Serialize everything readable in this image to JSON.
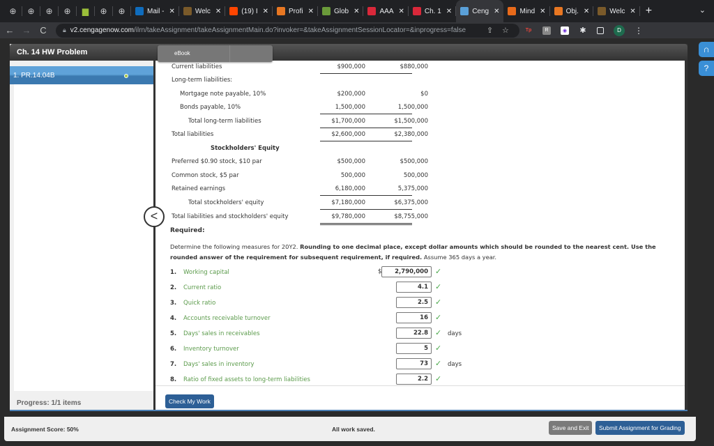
{
  "browser": {
    "tabs": [
      {
        "label": "Mail -",
        "icon": "outlook-icon",
        "color": "#0f6cbd"
      },
      {
        "label": "Welc",
        "icon": "welcome-icon",
        "color": "#7a5a2a"
      },
      {
        "label": "(19) I",
        "icon": "reddit-icon",
        "color": "#ff4500"
      },
      {
        "label": "Profi",
        "icon": "chegg-icon",
        "color": "#e87722"
      },
      {
        "label": "Glob",
        "icon": "bnc-icon",
        "color": "#6a9a3a"
      },
      {
        "label": "AAA",
        "icon": "aaa-icon",
        "color": "#d9283a"
      },
      {
        "label": "Ch. 1",
        "icon": "cengage-icon",
        "color": "#d9283a"
      },
      {
        "label": "Ceng",
        "icon": "cengage-icon",
        "color": "#5aa0d8",
        "active": true
      },
      {
        "label": "Mind",
        "icon": "mindtap-icon",
        "color": "#e86a1a"
      },
      {
        "label": "Obj.",
        "icon": "chegg-icon",
        "color": "#e87722"
      },
      {
        "label": "Welc",
        "icon": "welcome-icon",
        "color": "#7a5a2a"
      }
    ],
    "new_tab": "+",
    "tab_menu": "⌄",
    "url_host": "v2.cengagenow.com",
    "url_path": "/ilrn/takeAssignment/takeAssignmentMain.do?invoker=&takeAssignmentSessionLocator=&inprogress=false",
    "profile_initial": "D"
  },
  "sidebar": {
    "title": "Ch. 14 HW Problem",
    "items": [
      {
        "label": "1. PR.14.04B",
        "status": "complete"
      }
    ],
    "progress": "Progress:  1/1 items"
  },
  "main": {
    "tabs": [
      {
        "label": "eBook"
      }
    ],
    "balance_sheet": [
      {
        "label": "Current liabilities",
        "v1": "$900,000",
        "v2": "$880,000",
        "indent": 0,
        "rule": "single"
      },
      {
        "label": "Long-term liabilities:",
        "v1": "",
        "v2": "",
        "indent": 0
      },
      {
        "label": "Mortgage note payable, 10%",
        "v1": "$200,000",
        "v2": "$0",
        "indent": 1
      },
      {
        "label": "Bonds payable, 10%",
        "v1": "1,500,000",
        "v2": "1,500,000",
        "indent": 1,
        "rule": "single"
      },
      {
        "label": "Total long-term liabilities",
        "v1": "$1,700,000",
        "v2": "$1,500,000",
        "indent": 2,
        "rule": "single"
      },
      {
        "label": "Total liabilities",
        "v1": "$2,600,000",
        "v2": "$2,380,000",
        "indent": 0,
        "rule": "single"
      },
      {
        "label": "Stockholders' Equity",
        "v1": "",
        "v2": "",
        "heading": true
      },
      {
        "label": "Preferred $0.90 stock, $10 par",
        "v1": "$500,000",
        "v2": "$500,000",
        "indent": 0
      },
      {
        "label": "Common stock, $5 par",
        "v1": "500,000",
        "v2": "500,000",
        "indent": 0
      },
      {
        "label": "Retained earnings",
        "v1": "6,180,000",
        "v2": "5,375,000",
        "indent": 0,
        "rule": "single"
      },
      {
        "label": "Total stockholders' equity",
        "v1": "$7,180,000",
        "v2": "$6,375,000",
        "indent": 2,
        "rule": "single"
      },
      {
        "label": "Total liabilities and stockholders' equity",
        "v1": "$9,780,000",
        "v2": "$8,755,000",
        "indent": 0,
        "rule": "double"
      }
    ],
    "required_label": "Required:",
    "instructions_plain": "Determine the following measures for 20Y2. ",
    "instructions_bold": "Rounding to one decimal place, except dollar amounts which should be rounded to the nearest cent. Use the rounded answer of the requirement for subsequent requirement, if required.",
    "instructions_tail": " Assume 365 days a year.",
    "questions": [
      {
        "num": "1.",
        "label": "Working capital",
        "prefix": "$",
        "answer": "2,790,000",
        "unit": "",
        "correct": true
      },
      {
        "num": "2.",
        "label": "Current ratio",
        "prefix": "",
        "answer": "4.1",
        "unit": "",
        "correct": true
      },
      {
        "num": "3.",
        "label": "Quick ratio",
        "prefix": "",
        "answer": "2.5",
        "unit": "",
        "correct": true
      },
      {
        "num": "4.",
        "label": "Accounts receivable turnover",
        "prefix": "",
        "answer": "16",
        "unit": "",
        "correct": true
      },
      {
        "num": "5.",
        "label": "Days' sales in receivables",
        "prefix": "",
        "answer": "22.8",
        "unit": "days",
        "correct": true
      },
      {
        "num": "6.",
        "label": "Inventory turnover",
        "prefix": "",
        "answer": "5",
        "unit": "",
        "correct": true
      },
      {
        "num": "7.",
        "label": "Days' sales in inventory",
        "prefix": "",
        "answer": "73",
        "unit": "days",
        "correct": true
      },
      {
        "num": "8.",
        "label": "Ratio of fixed assets to long-term liabilities",
        "prefix": "",
        "answer": "2.2",
        "unit": "",
        "correct": true
      }
    ],
    "check_button": "Check My Work"
  },
  "footer": {
    "score": "Assignment Score:   50%",
    "status": "All work saved.",
    "save_exit": "Save and Exit",
    "submit": "Submit Assignment for Grading"
  },
  "icons": {
    "check": "✓",
    "collapse": "<",
    "support": "🎧",
    "help": "?"
  }
}
